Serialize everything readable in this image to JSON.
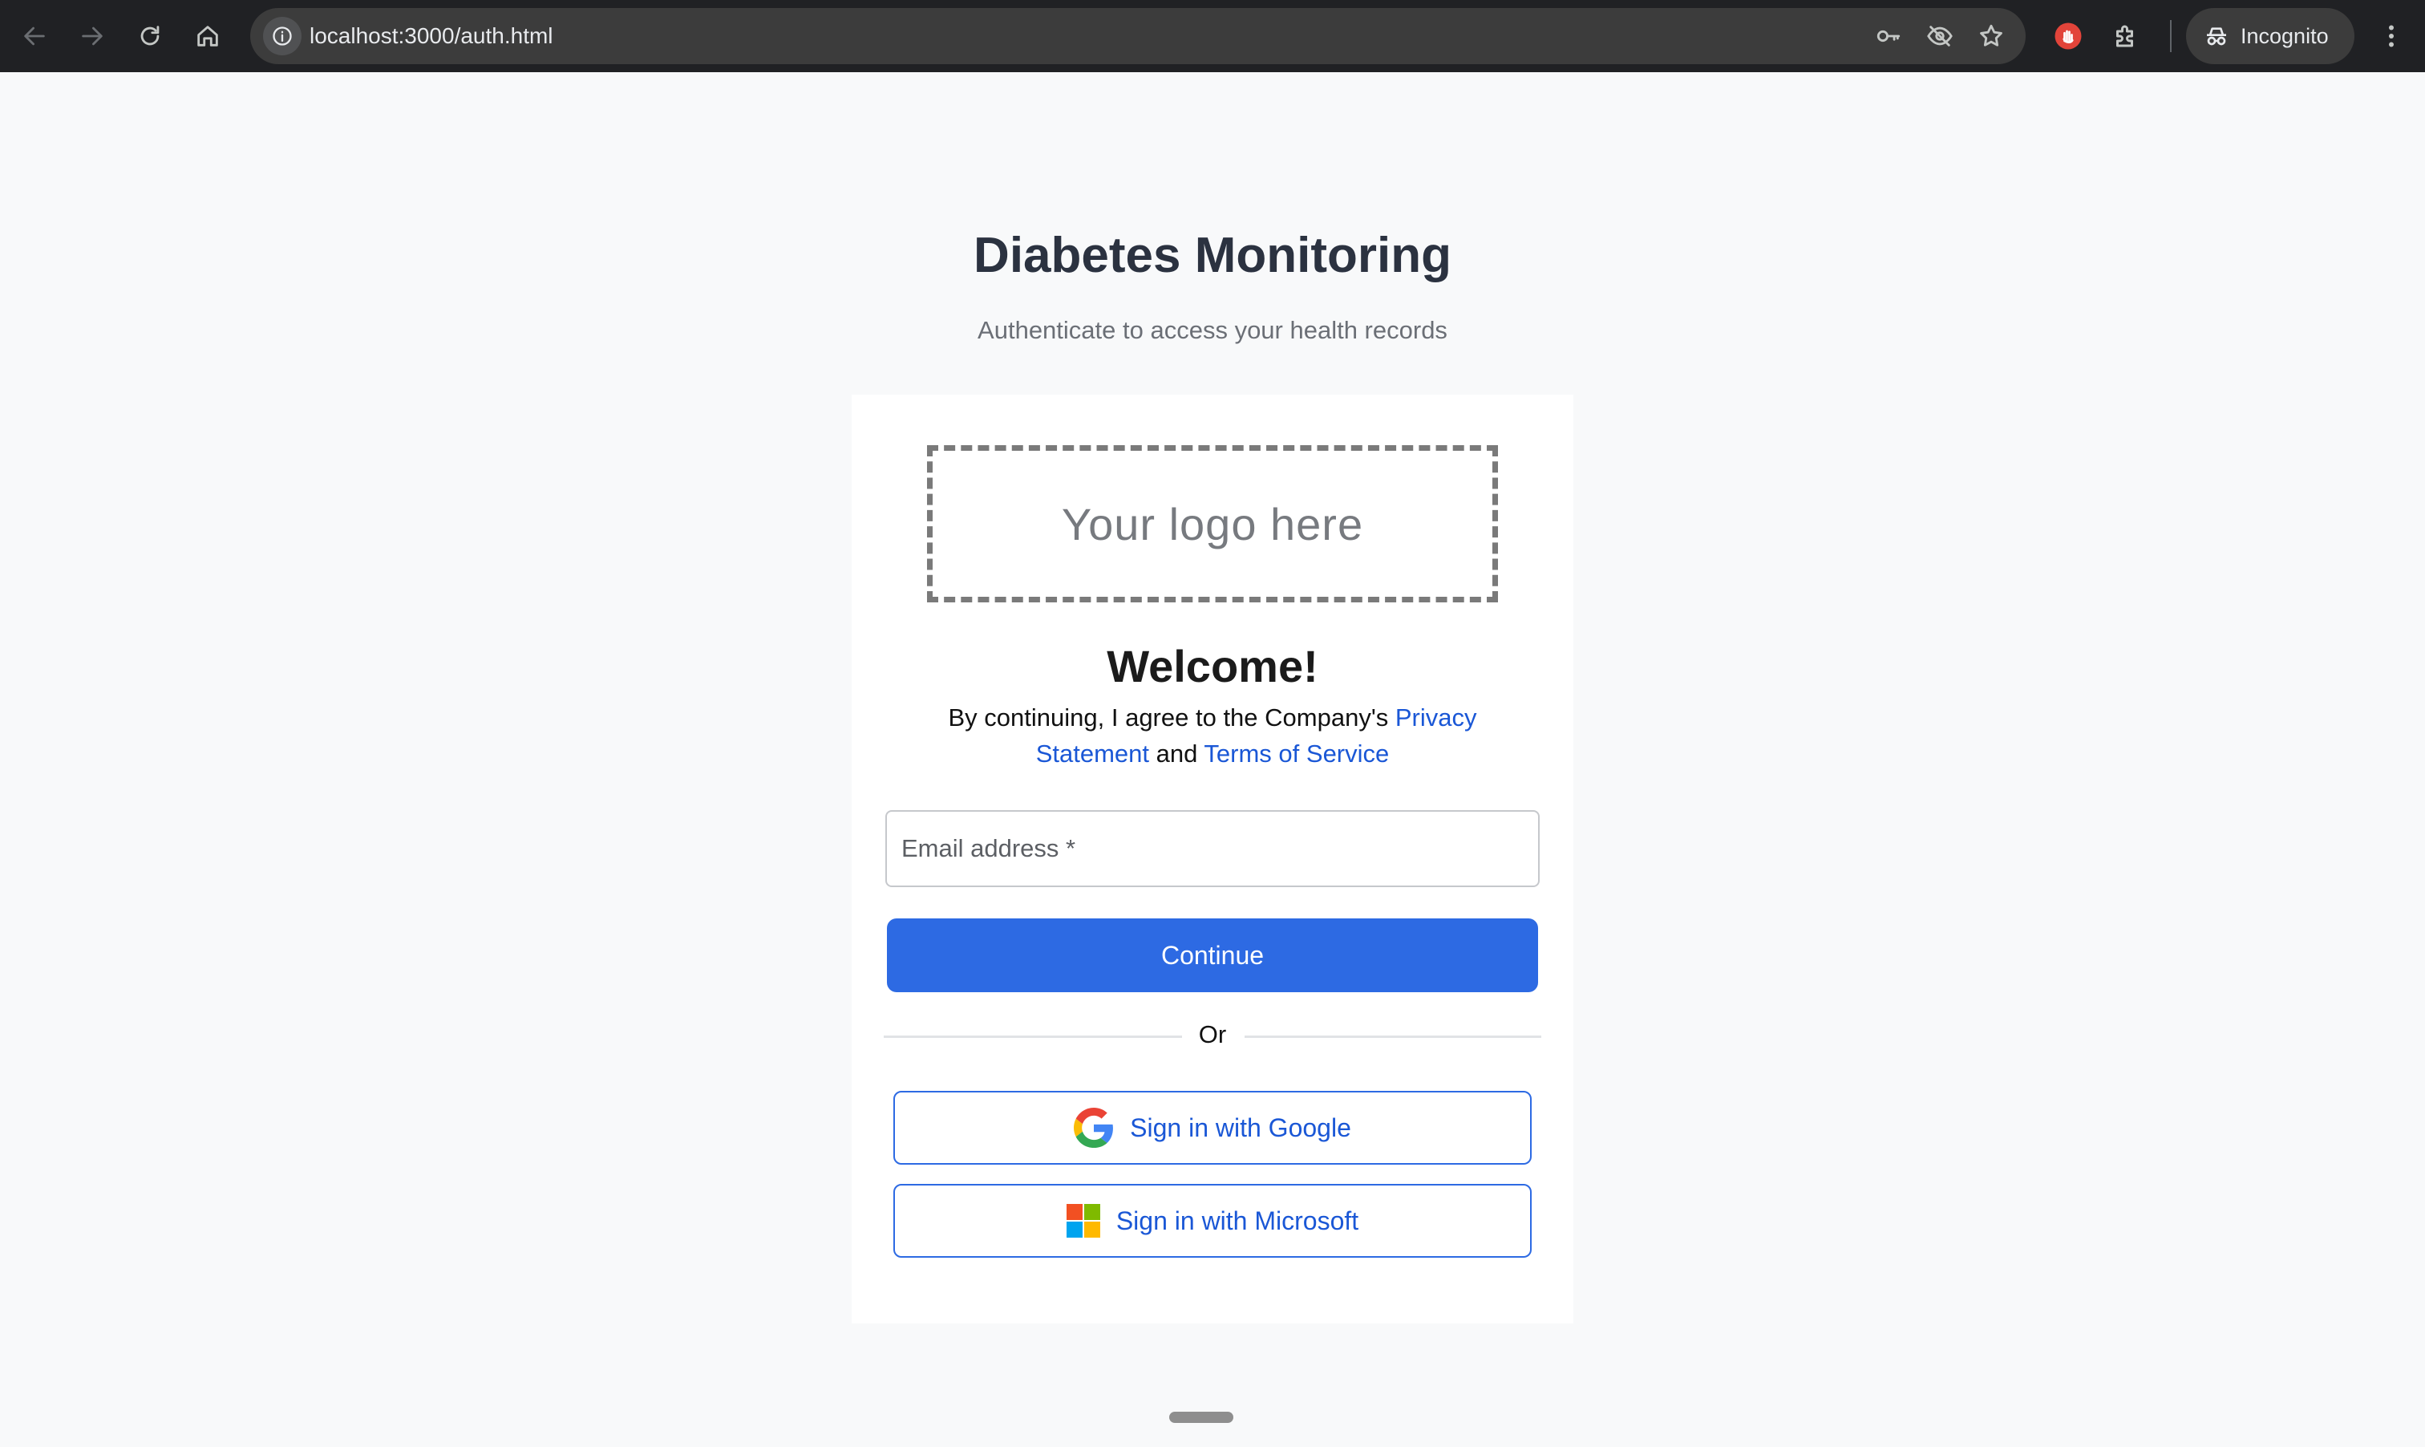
{
  "browser": {
    "url": "localhost:3000/auth.html",
    "incognito_label": "Incognito"
  },
  "page": {
    "title": "Diabetes Monitoring",
    "subtitle": "Authenticate to access your health records"
  },
  "card": {
    "logo_placeholder": "Your logo here",
    "welcome": "Welcome!",
    "legal_prefix": "By continuing, I agree to the Company's ",
    "privacy_link": "Privacy Statement",
    "legal_and": " and ",
    "terms_link": "Terms of Service",
    "email_placeholder": "Email address *",
    "email_value": "",
    "continue_label": "Continue",
    "divider_text": "Or",
    "google_label": "Sign in with Google",
    "microsoft_label": "Sign in with Microsoft"
  },
  "colors": {
    "primary": "#2d6ae3",
    "link": "#1a57d6",
    "page_background": "#f8f9fa",
    "chrome_background": "#202124"
  }
}
